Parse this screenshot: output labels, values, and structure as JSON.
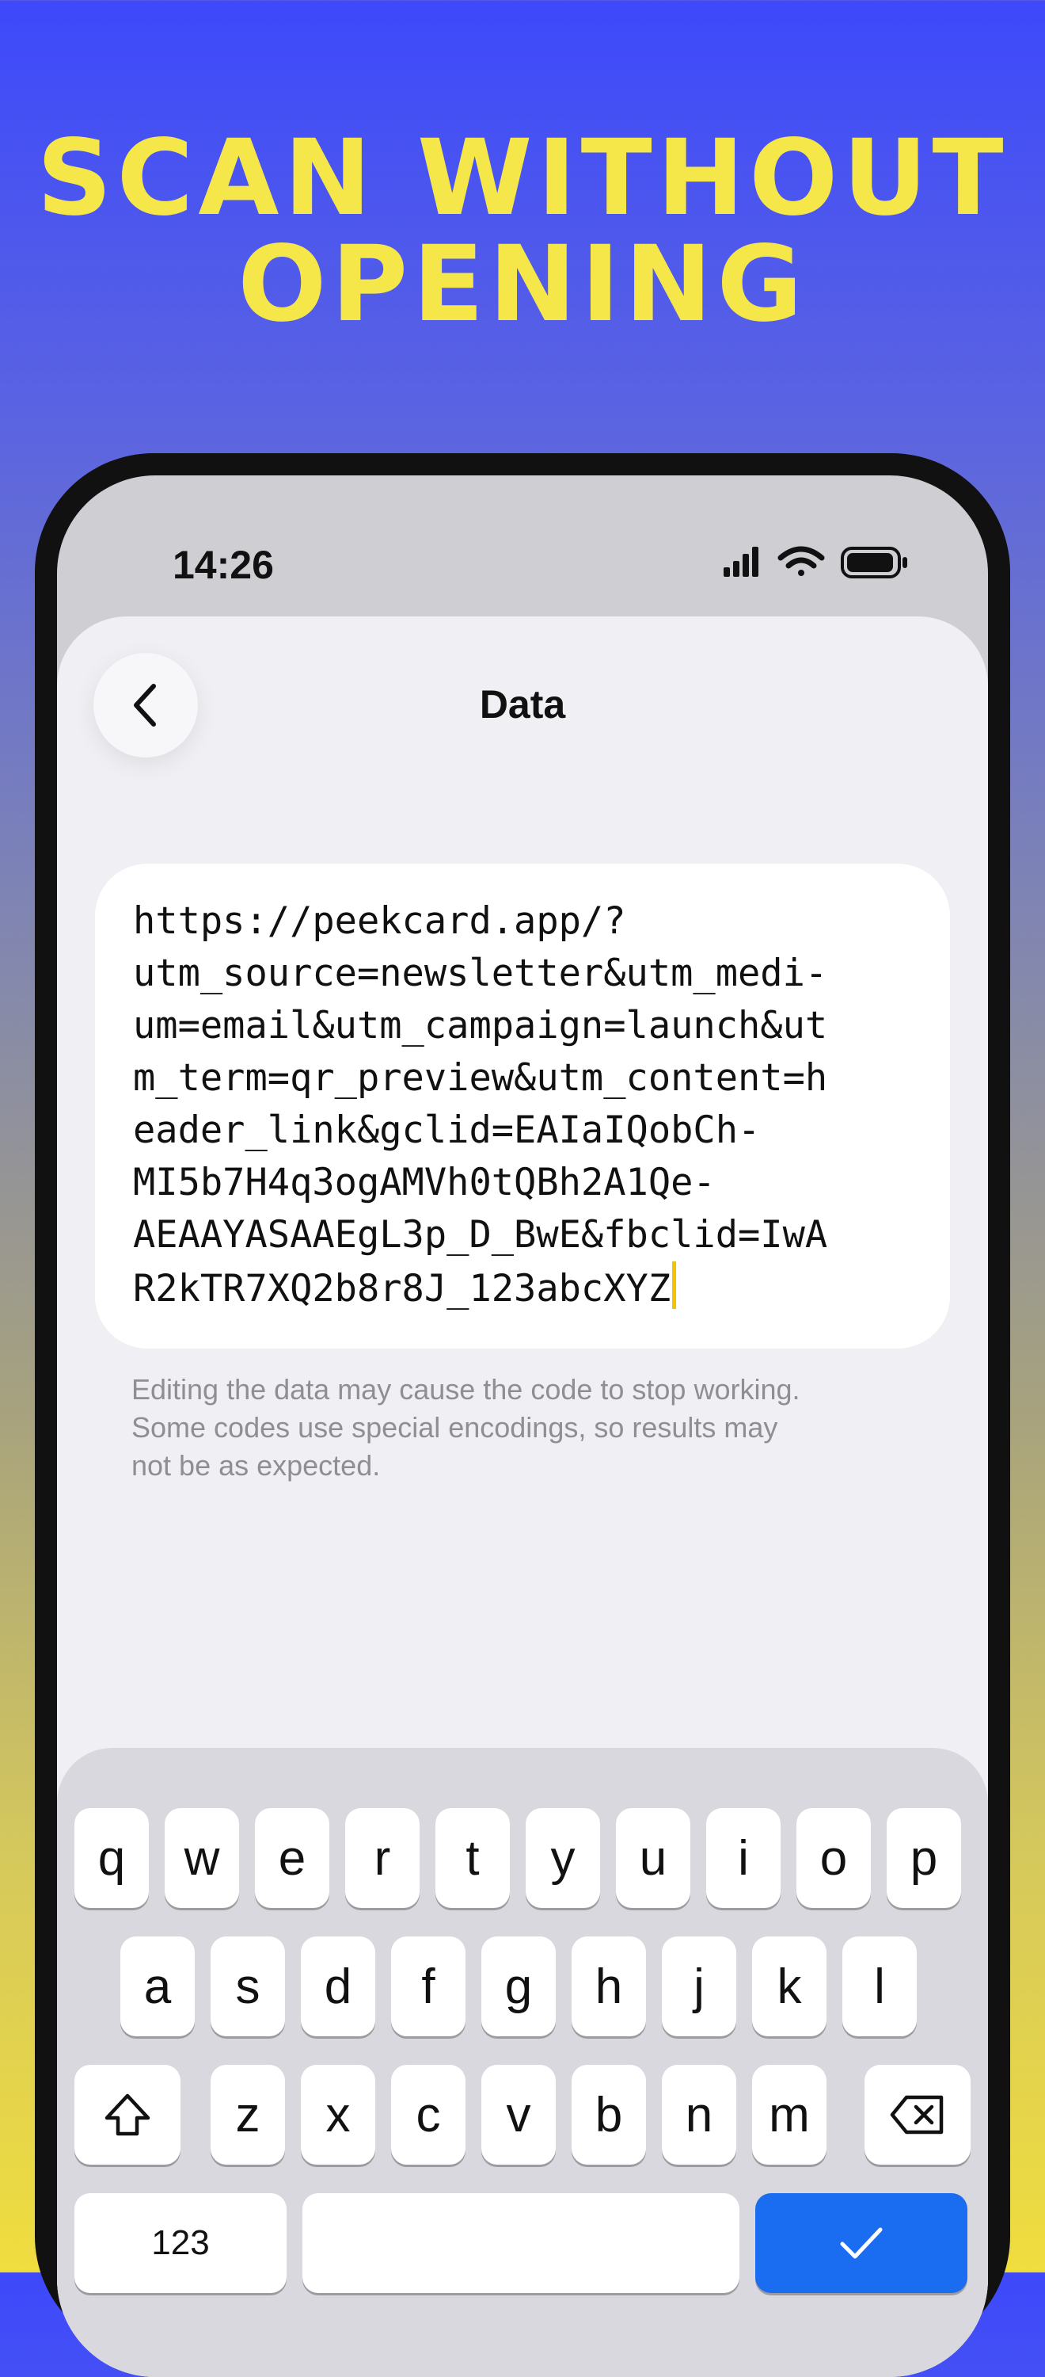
{
  "promo": {
    "headline_line1": "SCAN WITHOUT",
    "headline_line2": "OPENING"
  },
  "status_bar": {
    "time": "14:26",
    "icons": [
      "cellular-signal-icon",
      "wifi-icon",
      "battery-icon"
    ]
  },
  "nav": {
    "title": "Data",
    "back_icon": "chevron-left-icon"
  },
  "data_field": {
    "lines": [
      "https://peekcard.app/?",
      "utm_source=newsletter&utm_medi-",
      "um=email&utm_campaign=launch&ut",
      "m_term=qr_preview&utm_content=h",
      "eader_link&gclid=EAIaIQobCh-",
      "MI5b7H4q3ogAMVh0tQBh2A1Qe-",
      "AEAAYASAAEgL3p_D_BwE&fbclid=IwA",
      "R2kTR7XQ2b8r8J_123abcXYZ"
    ]
  },
  "warning_text": {
    "line1": "Editing the data may cause the code to stop working.",
    "line2": "Some codes use special encodings, so results may",
    "line3": "not be as expected."
  },
  "keyboard": {
    "row1": [
      "q",
      "w",
      "e",
      "r",
      "t",
      "y",
      "u",
      "i",
      "o",
      "p"
    ],
    "row2": [
      "a",
      "s",
      "d",
      "f",
      "g",
      "h",
      "j",
      "k",
      "l"
    ],
    "row3": [
      "z",
      "x",
      "c",
      "v",
      "b",
      "n",
      "m"
    ],
    "numbers_label": "123",
    "shift_icon": "shift-icon",
    "delete_icon": "delete-backspace-icon",
    "done_icon": "checkmark-icon"
  },
  "colors": {
    "headline": "#f5e74a",
    "caret": "#f2c400",
    "done_key": "#1a6cf0"
  }
}
